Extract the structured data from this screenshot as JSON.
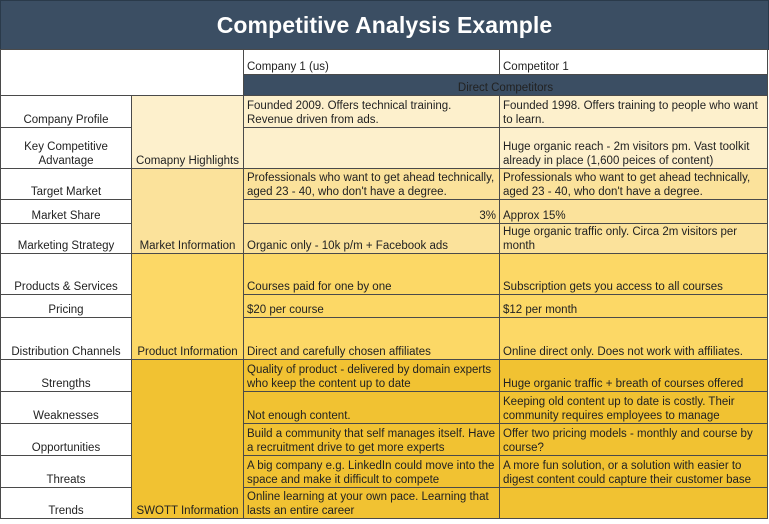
{
  "title": "Competitive Analysis Example",
  "columns": {
    "company": "Company 1 (us)",
    "competitor": "Competitor 1",
    "group_label": "Direct Competitors"
  },
  "colors": {
    "header_bg": "#3b4e63",
    "company_highlights": "#fdf0cc",
    "market_information": "#fbe29b",
    "product_information": "#fcd866",
    "swott_information": "#f1c232"
  },
  "sections": [
    {
      "label": "Comapny Highlights",
      "rows": [
        {
          "label": "Company Profile",
          "company": "Founded 2009. Offers technical training. Revenue driven from ads.",
          "competitor": "Founded 1998. Offers training to people who want to learn."
        },
        {
          "label": "Key Competitive Advantage",
          "company": "",
          "competitor": "Huge organic reach - 2m visitors pm. Vast toolkit already in place (1,600 peices of content)"
        }
      ]
    },
    {
      "label": "Market Information",
      "rows": [
        {
          "label": "Target Market",
          "company": "Professionals who want to get ahead technically, aged 23 - 40, who don't have a degree.",
          "competitor": "Professionals who want to get ahead technically, aged 23 - 40, who don't have a degree."
        },
        {
          "label": "Market Share",
          "company": "3%",
          "competitor": "Approx 15%"
        },
        {
          "label": "Marketing Strategy",
          "company": "Organic only - 10k p/m + Facebook ads",
          "competitor": "Huge organic traffic only. Circa 2m visitors per month"
        }
      ]
    },
    {
      "label": "Product Information",
      "rows": [
        {
          "label": "Products & Services",
          "company": "Courses paid for one by one",
          "competitor": "Subscription gets you access to all courses"
        },
        {
          "label": "Pricing",
          "company": "$20 per course",
          "competitor": "$12 per month"
        },
        {
          "label": "Distribution Channels",
          "company": "Direct and carefully chosen affiliates",
          "competitor": "Online direct only. Does not work with affiliates."
        }
      ]
    },
    {
      "label": "SWOTT Information",
      "rows": [
        {
          "label": "Strengths",
          "company": "Quality of product - delivered by domain experts who keep the content up to date",
          "competitor": "Huge organic traffic + breath of courses offered"
        },
        {
          "label": "Weaknesses",
          "company": "Not enough content.",
          "competitor": "Keeping old content up to date is costly. Their community requires employees to manage"
        },
        {
          "label": "Opportunities",
          "company": "Build a community that self manages itself. Have a recruitment drive to get more experts",
          "competitor": "Offer two pricing models - monthly and course by course?"
        },
        {
          "label": "Threats",
          "company": "A big company e.g. LinkedIn could move into the space and make it difficult to compete",
          "competitor": "A more fun solution, or a solution with easier to digest content could capture their customer base"
        },
        {
          "label": "Trends",
          "company": "Online learning at your own pace. Learning that lasts an entire career",
          "competitor": ""
        }
      ]
    }
  ]
}
